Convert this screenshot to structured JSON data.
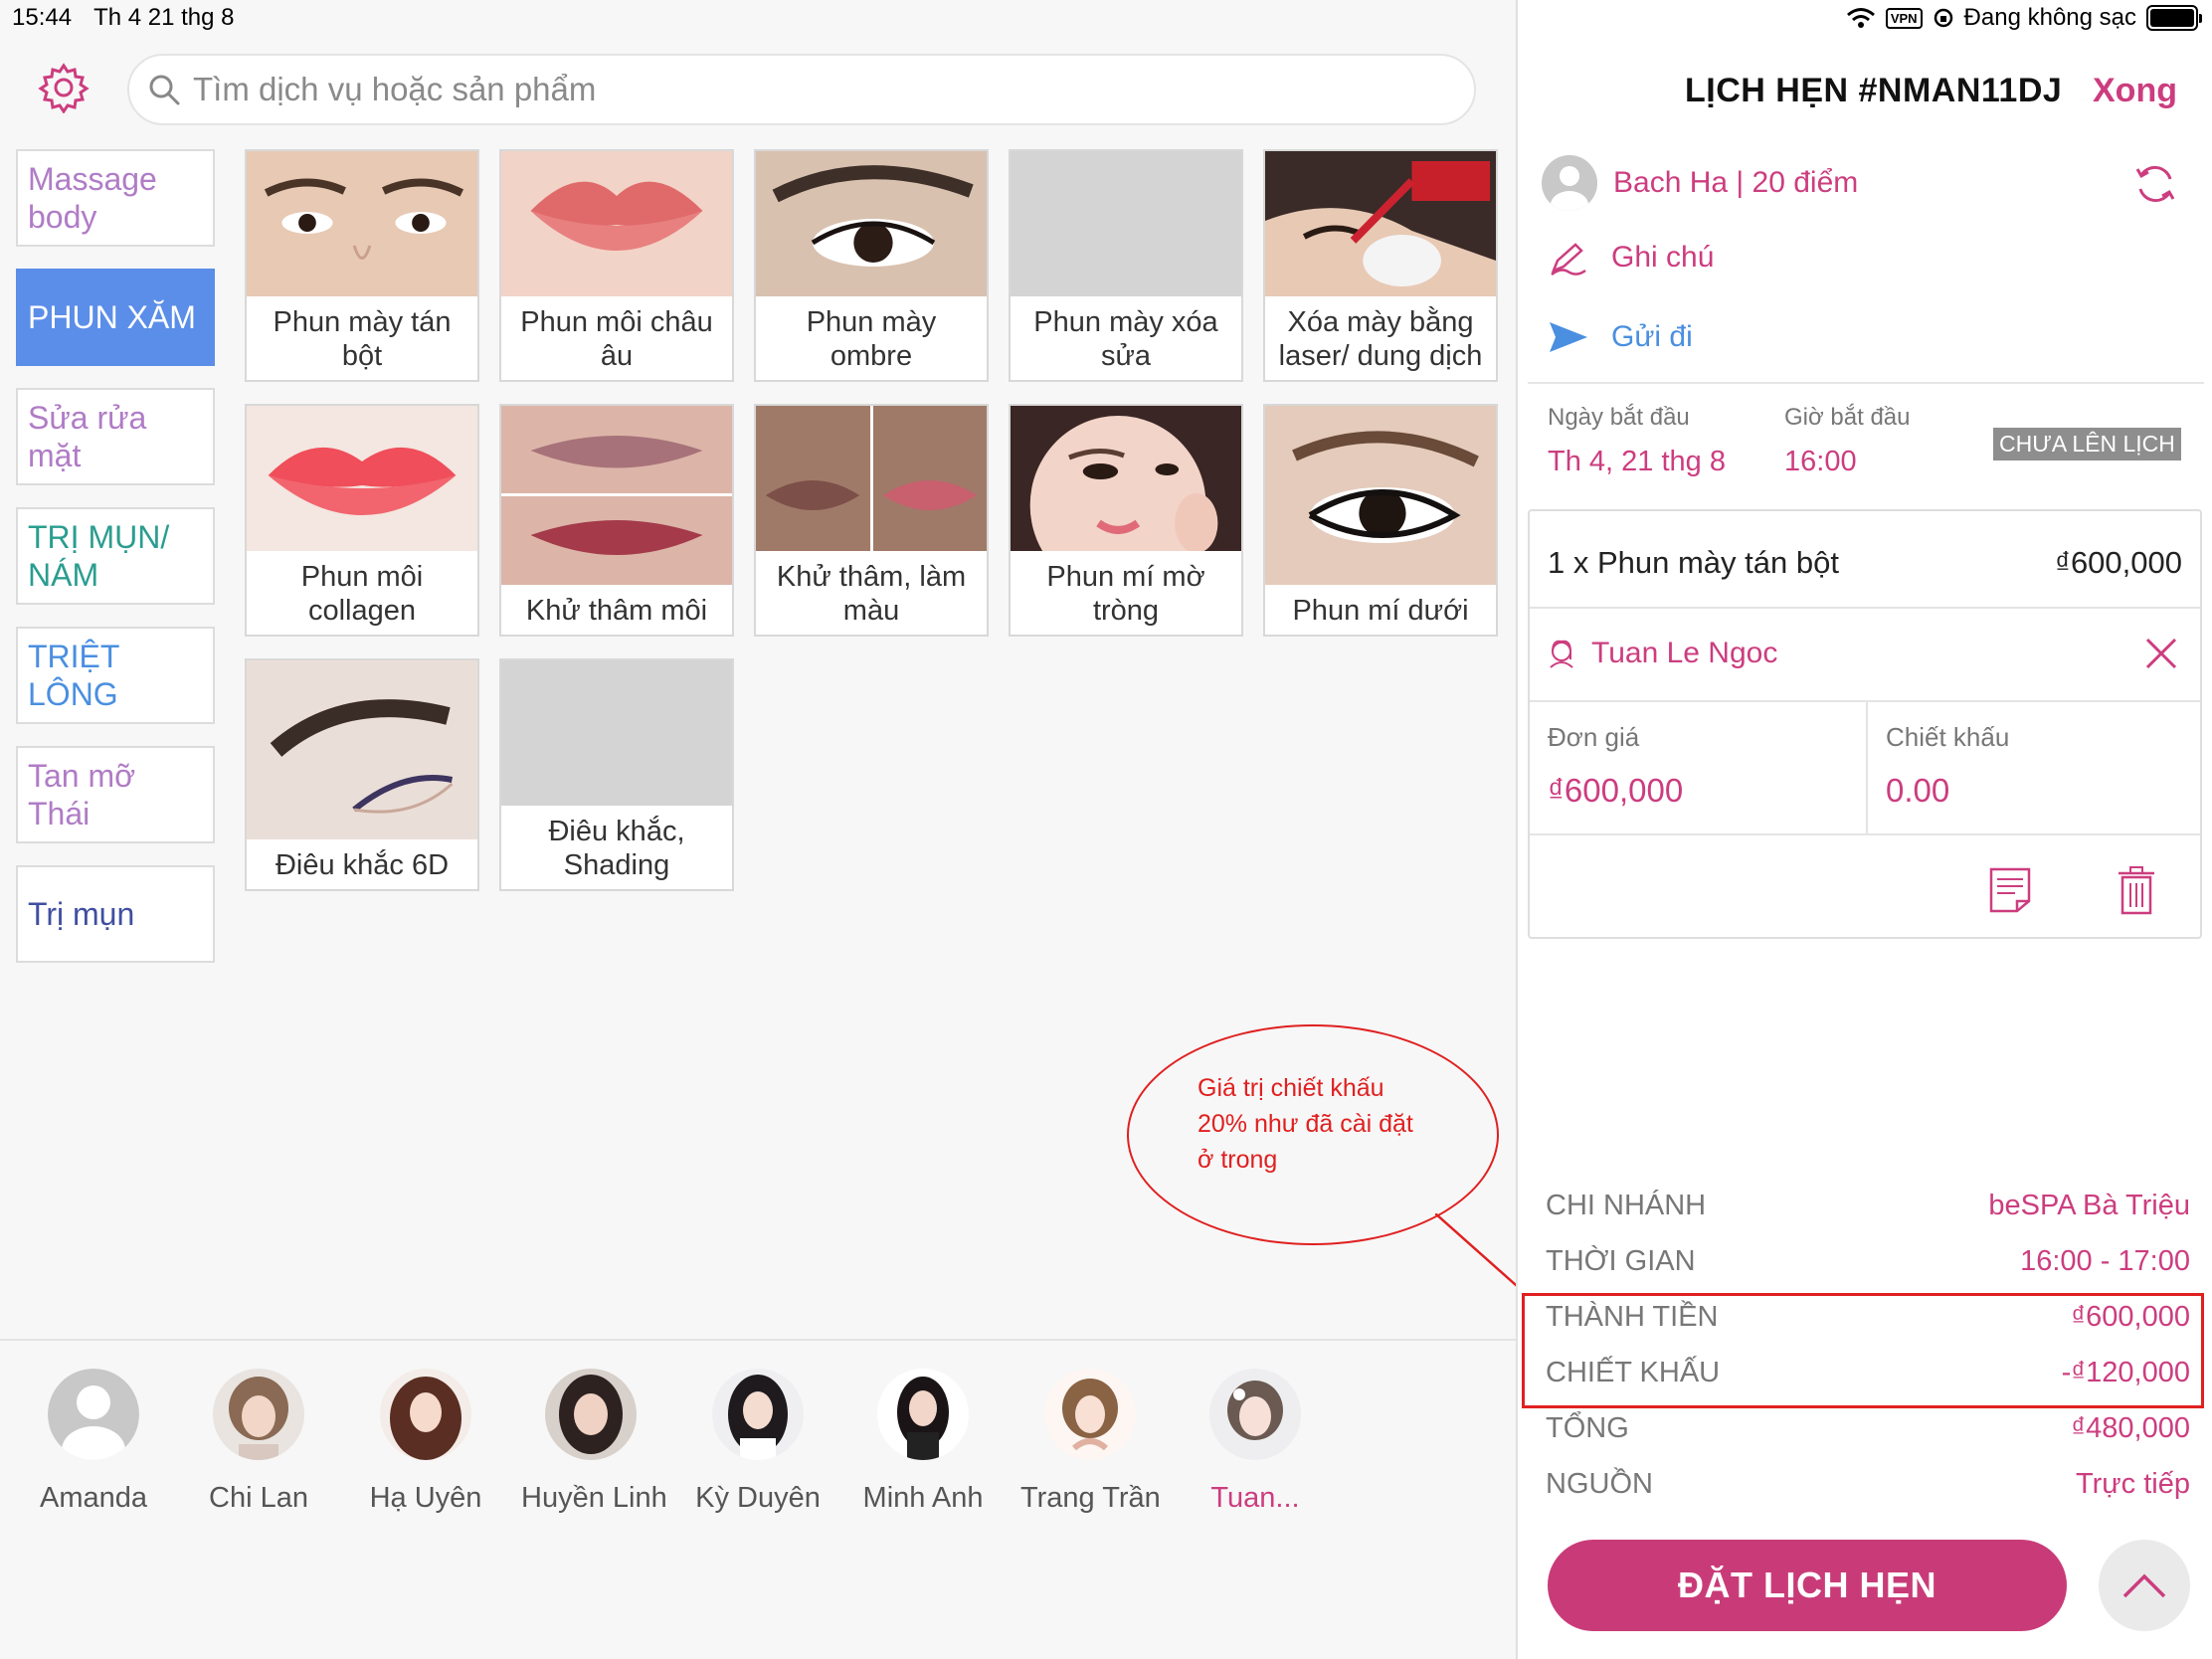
{
  "status_bar": {
    "time": "15:44",
    "date": "Th 4 21 thg 8",
    "vpn": "VPN",
    "charging": "Đang không sạc"
  },
  "search": {
    "placeholder": "Tìm dịch vụ hoặc sản phẩm"
  },
  "categories": [
    {
      "label": "Massage body",
      "color": "#b07cc6"
    },
    {
      "label": "PHUN XĂM",
      "color": "#ffffff"
    },
    {
      "label": "Sửa rửa mặt",
      "color": "#b07cc6"
    },
    {
      "label": "TRỊ MỤN/ NÁM",
      "color": "#2a9d8f"
    },
    {
      "label": "TRIỆT LÔNG",
      "color": "#4a8fe0"
    },
    {
      "label": "Tan mỡ Thái",
      "color": "#b07cc6"
    },
    {
      "label": "Trị mụn",
      "color": "#3f4fa0"
    }
  ],
  "services": [
    {
      "label": "Phun mày tán bột",
      "icon": "eyebrow-photo"
    },
    {
      "label": "Phun môi châu âu",
      "icon": "lips-photo"
    },
    {
      "label": "Phun mày ombre",
      "icon": "eye-photo"
    },
    {
      "label": "Phun mày xóa sửa",
      "icon": "no-photo"
    },
    {
      "label": "Xóa mày bằng laser/ dung dịch",
      "icon": "laser-photo"
    },
    {
      "label": "Phun môi collagen",
      "icon": "lips-photo"
    },
    {
      "label": "Khử thâm môi",
      "icon": "lips-photo"
    },
    {
      "label": "Khử thâm, làm màu",
      "icon": "lips-photo"
    },
    {
      "label": "Phun mí mờ tròng",
      "icon": "face-photo"
    },
    {
      "label": "Phun mí dưới",
      "icon": "eye-photo"
    },
    {
      "label": "Điêu khắc 6D",
      "icon": "eyebrow-photo"
    },
    {
      "label": "Điêu khắc, Shading",
      "icon": "no-photo"
    }
  ],
  "staff": [
    {
      "name": "Amanda",
      "selected": false
    },
    {
      "name": "Chi Lan",
      "selected": false
    },
    {
      "name": "Hạ Uyên",
      "selected": false
    },
    {
      "name": "Huyền Linh",
      "selected": false
    },
    {
      "name": "Kỳ Duyên",
      "selected": false
    },
    {
      "name": "Minh Anh",
      "selected": false
    },
    {
      "name": "Trang Trần",
      "selected": false
    },
    {
      "name": "Tuan...",
      "selected": true
    }
  ],
  "annotation": {
    "line1": "Giá trị chiết khấu",
    "line2": "20% như đã cài đặt",
    "line3": "ở trong"
  },
  "appointment": {
    "title": "LỊCH HẸN #NMAN11DJ",
    "done": "Xong",
    "customer": "Bach Ha |  20 điểm",
    "note": "Ghi chú",
    "send": "Gửi đi",
    "start_date_label": "Ngày bắt đầu",
    "start_date": "Th 4, 21 thg 8",
    "start_time_label": "Giờ bắt đầu",
    "start_time": "16:00",
    "status": "CHƯA LÊN LỊCH",
    "item": {
      "service": "1 x Phun mày tán bột",
      "price": "₫600,000",
      "technician": "Tuan Le Ngoc",
      "unit_price_label": "Đơn giá",
      "unit_price": "₫600,000",
      "discount_label": "Chiết khấu",
      "discount": "0.00"
    },
    "summary": [
      {
        "key": "CHI NHÁNH",
        "value": "beSPA Bà Triệu"
      },
      {
        "key": "THỜI GIAN",
        "value": "16:00 - 17:00"
      },
      {
        "key": "THÀNH TIỀN",
        "value": "₫600,000"
      },
      {
        "key": "CHIẾT KHẤU",
        "value": "-₫120,000"
      },
      {
        "key": "TỔNG",
        "value": "₫480,000"
      },
      {
        "key": "NGUỒN",
        "value": "Trực tiếp"
      }
    ],
    "book_button": "ĐẶT LỊCH HẸN"
  },
  "colors": {
    "accent": "#cc3d7f",
    "active_category": "#5b8ee8",
    "annotation": "#e02020"
  }
}
